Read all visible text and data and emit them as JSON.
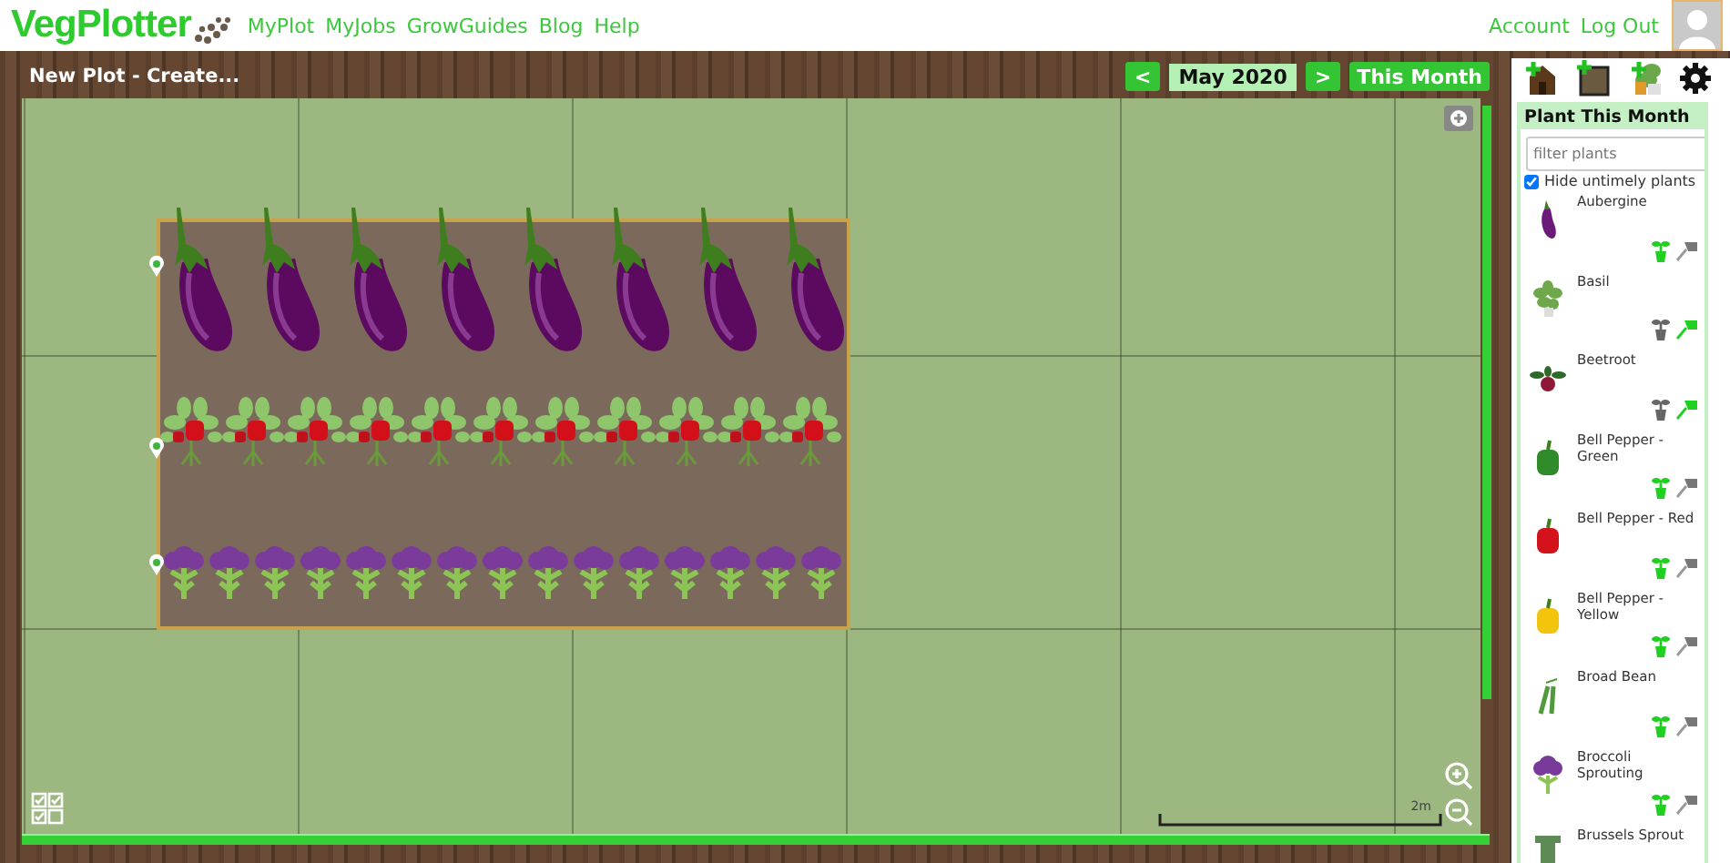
{
  "header": {
    "logo": "VegPlotter",
    "nav": [
      {
        "label": "MyPlot"
      },
      {
        "label": "MyJobs"
      },
      {
        "label": "GrowGuides"
      },
      {
        "label": "Blog"
      },
      {
        "label": "Help"
      }
    ],
    "account": [
      {
        "label": "Account"
      },
      {
        "label": "Log Out"
      }
    ]
  },
  "toolbar": {
    "title": "New Plot - Create...",
    "prev": "<",
    "month": "May 2020",
    "next": ">",
    "this_month": "This Month"
  },
  "plot": {
    "scale_label": "2m",
    "bed": {
      "rows": [
        {
          "kind": "aubergine",
          "plants": [
            {
              "kind": "aubergine"
            },
            {
              "kind": "aubergine"
            },
            {
              "kind": "aubergine"
            },
            {
              "kind": "aubergine"
            },
            {
              "kind": "aubergine"
            },
            {
              "kind": "aubergine"
            },
            {
              "kind": "aubergine"
            },
            {
              "kind": "aubergine"
            }
          ]
        },
        {
          "kind": "pepper",
          "plants": [
            {
              "kind": "pepper"
            },
            {
              "kind": "pepper"
            },
            {
              "kind": "pepper"
            },
            {
              "kind": "pepper"
            },
            {
              "kind": "pepper"
            },
            {
              "kind": "pepper"
            },
            {
              "kind": "pepper"
            },
            {
              "kind": "pepper"
            },
            {
              "kind": "pepper"
            },
            {
              "kind": "pepper"
            },
            {
              "kind": "pepper"
            }
          ]
        },
        {
          "kind": "broccoli",
          "plants": [
            {
              "kind": "broccoli"
            },
            {
              "kind": "broccoli"
            },
            {
              "kind": "broccoli"
            },
            {
              "kind": "broccoli"
            },
            {
              "kind": "broccoli"
            },
            {
              "kind": "broccoli"
            },
            {
              "kind": "broccoli"
            },
            {
              "kind": "broccoli"
            },
            {
              "kind": "broccoli"
            },
            {
              "kind": "broccoli"
            },
            {
              "kind": "broccoli"
            },
            {
              "kind": "broccoli"
            },
            {
              "kind": "broccoli"
            },
            {
              "kind": "broccoli"
            },
            {
              "kind": "broccoli"
            }
          ]
        }
      ]
    }
  },
  "panel": {
    "title": "Plant This Month",
    "filter": {
      "placeholder": "filter plants"
    },
    "hide_untimely": {
      "label": "Hide untimely plants",
      "checked": true
    },
    "plants": [
      {
        "name": "Aubergine",
        "kind": "aubergine",
        "sow": true,
        "plant_out": false
      },
      {
        "name": "Basil",
        "kind": "basil",
        "sow": false,
        "plant_out": true
      },
      {
        "name": "Beetroot",
        "kind": "beetroot",
        "sow": false,
        "plant_out": true
      },
      {
        "name": "Bell Pepper - Green",
        "kind": "pepper_green",
        "sow": true,
        "plant_out": false
      },
      {
        "name": "Bell Pepper - Red",
        "kind": "pepper_red",
        "sow": true,
        "plant_out": false
      },
      {
        "name": "Bell Pepper - Yellow",
        "kind": "pepper_yellow",
        "sow": true,
        "plant_out": false
      },
      {
        "name": "Broad Bean",
        "kind": "broad_bean",
        "sow": true,
        "plant_out": false
      },
      {
        "name": "Broccoli Sprouting",
        "kind": "broccoli",
        "sow": true,
        "plant_out": false
      },
      {
        "name": "Brussels Sprout",
        "kind": "brussels"
      }
    ]
  }
}
